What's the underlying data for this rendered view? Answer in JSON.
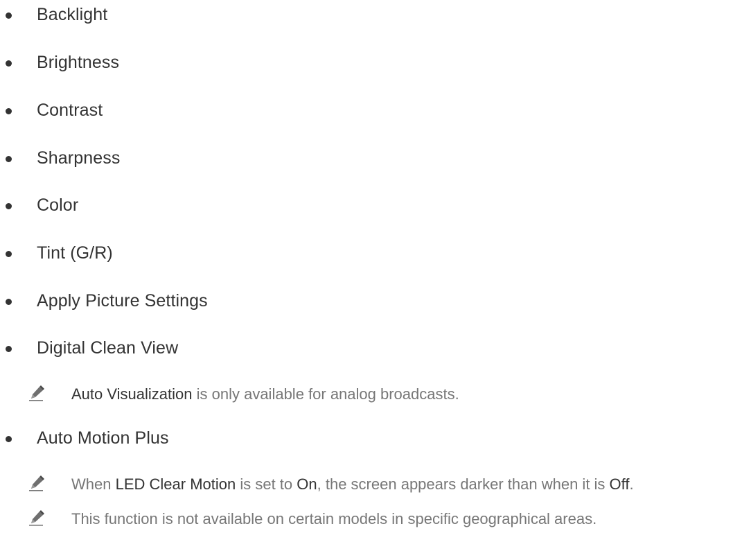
{
  "list": {
    "items": [
      {
        "label": "Backlight"
      },
      {
        "label": "Brightness"
      },
      {
        "label": "Contrast"
      },
      {
        "label": "Sharpness"
      },
      {
        "label": "Color"
      },
      {
        "label": "Tint (G/R)"
      },
      {
        "label": "Apply Picture Settings"
      },
      {
        "label": "Digital Clean View"
      },
      {
        "label": "Auto Motion Plus"
      }
    ]
  },
  "notes": {
    "digital_clean_view": {
      "strong": "Auto Visualization",
      "rest": " is only available for analog broadcasts."
    },
    "auto_motion_plus_1": {
      "part1": "When ",
      "strong1": "LED Clear Motion",
      "part2": " is set to ",
      "strong2": "On",
      "part3": ", the screen appears darker than when it is ",
      "strong3": "Off",
      "part4": "."
    },
    "auto_motion_plus_2": {
      "text": "This function is not available on certain models in specific geographical areas."
    }
  },
  "icons": {
    "bullet": "bullet-dot",
    "note": "pencil-icon"
  },
  "colors": {
    "text": "#333333",
    "note_text": "#777777"
  }
}
